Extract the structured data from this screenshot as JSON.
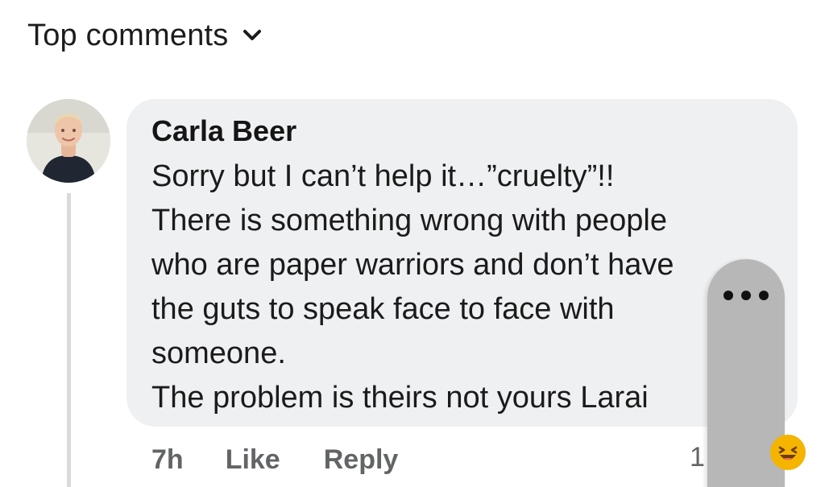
{
  "header": {
    "sort_label": "Top comments",
    "sort_icon": "chevron-down-icon"
  },
  "comment": {
    "author": "Carla Beer",
    "avatar_icon": "user-avatar",
    "text": "Sorry but I can’t help it…”cruelty”!!\nThere is something wrong with people\nwho are paper warriors and don’t have\nthe guts to speak face to face with\nsomeone.\nThe problem is theirs not yours Larai",
    "time": "7h",
    "like_label": "Like",
    "reply_label": "Reply",
    "reaction_count": "1",
    "reaction_icon": "haha-emoji-icon",
    "more_icon": "more-options-icon"
  },
  "colors": {
    "bubble": "#eff0f2",
    "text": "#1b1b1b",
    "meta": "#626466",
    "overlay": "#b7b7b7",
    "reaction": "#f4b400"
  }
}
